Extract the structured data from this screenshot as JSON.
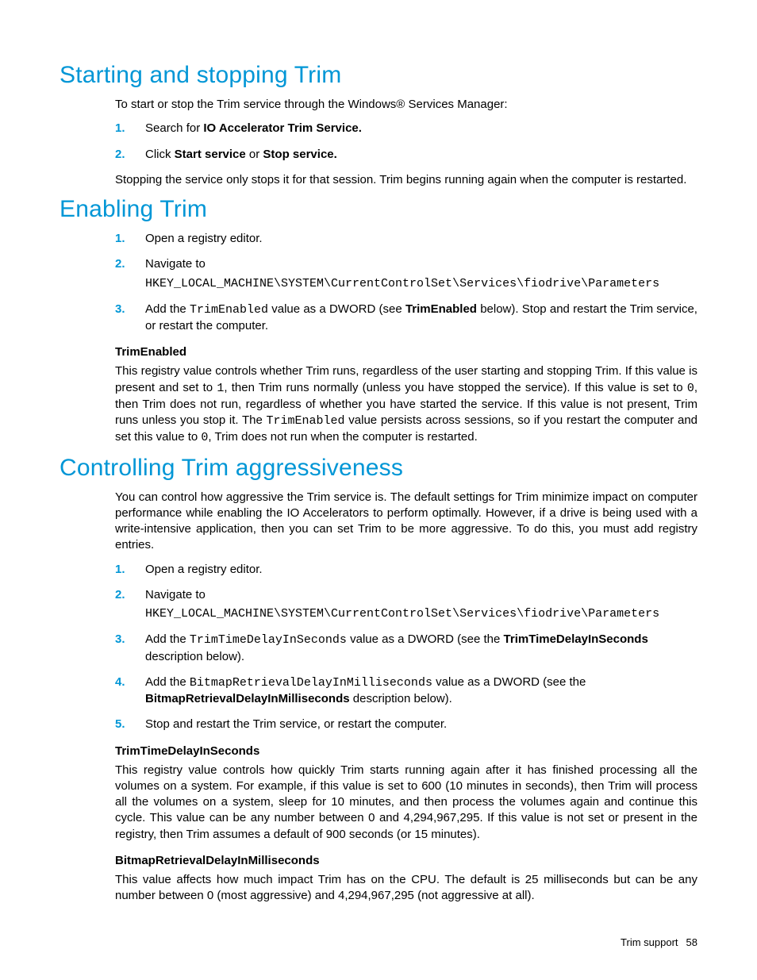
{
  "section1": {
    "heading": "Starting and stopping Trim",
    "intro": "To start or stop the Trim service through the Windows® Services Manager:",
    "step1_pre": "Search for ",
    "step1_bold": "IO Accelerator Trim Service.",
    "step2_pre": "Click ",
    "step2_bold1": "Start service",
    "step2_mid": " or ",
    "step2_bold2": "Stop service.",
    "outro": "Stopping the service only stops it for that session. Trim begins running again when the computer is restarted."
  },
  "section2": {
    "heading": "Enabling Trim",
    "step1": "Open a registry editor.",
    "step2_label": "Navigate to",
    "step2_path": "HKEY_LOCAL_MACHINE\\SYSTEM\\CurrentControlSet\\Services\\fiodrive\\Parameters",
    "step3_pre": "Add the ",
    "step3_mono": "TrimEnabled",
    "step3_mid1": " value as a DWORD (see ",
    "step3_bold": "TrimEnabled",
    "step3_post": " below). Stop and restart the Trim service, or restart the computer.",
    "subhead": "TrimEnabled",
    "para_a": "This registry value controls whether Trim runs, regardless of the user starting and stopping Trim. If this value is present and set to ",
    "para_mono1": "1",
    "para_b": ", then Trim runs normally (unless you have stopped the service). If this value is set to ",
    "para_mono0": "0",
    "para_c": ", then Trim does not run, regardless of whether you have started the service. If this value is not present, Trim runs unless you stop it. The ",
    "para_mono_te": "TrimEnabled",
    "para_d": " value persists across sessions, so if you restart the computer and set this value to ",
    "para_mono0b": "0",
    "para_e": ", Trim does not run when the computer is restarted."
  },
  "section3": {
    "heading": "Controlling Trim aggressiveness",
    "intro": "You can control how aggressive the Trim service is. The default settings for Trim minimize impact on computer performance while enabling the IO Accelerators to perform optimally. However, if a drive is being used with a write-intensive application, then you can set Trim to be more aggressive. To do this, you must add registry entries.",
    "step1": "Open a registry editor.",
    "step2_label": "Navigate to",
    "step2_path": "HKEY_LOCAL_MACHINE\\SYSTEM\\CurrentControlSet\\Services\\fiodrive\\Parameters",
    "step3_pre": "Add the ",
    "step3_mono": "TrimTimeDelayInSeconds",
    "step3_mid": " value as a DWORD (see the ",
    "step3_bold": "TrimTimeDelayInSeconds",
    "step3_post": " description below).",
    "step4_pre": "Add the ",
    "step4_mono": "BitmapRetrievalDelayInMilliseconds",
    "step4_mid": " value as a DWORD (see the ",
    "step4_bold": "BitmapRetrievalDelayInMilliseconds",
    "step4_post": " description below).",
    "step5": "Stop and restart the Trim service, or restart the computer.",
    "subhead1": "TrimTimeDelayInSeconds",
    "para1": "This registry value controls how quickly Trim starts running again after it has finished processing all the volumes on a system. For example, if this value is set to 600 (10 minutes in seconds), then Trim will process all the volumes on a system, sleep for 10 minutes, and then process the volumes again and continue this cycle. This value can be any number between 0 and 4,294,967,295. If this value is not set or present in the registry, then Trim assumes a default of 900 seconds (or 15 minutes).",
    "subhead2": "BitmapRetrievalDelayInMilliseconds",
    "para2": "This value affects how much impact Trim has on the CPU. The default is 25 milliseconds but can be any number between 0 (most aggressive) and 4,294,967,295 (not aggressive at all)."
  },
  "footer": {
    "label": "Trim support",
    "page": "58"
  }
}
